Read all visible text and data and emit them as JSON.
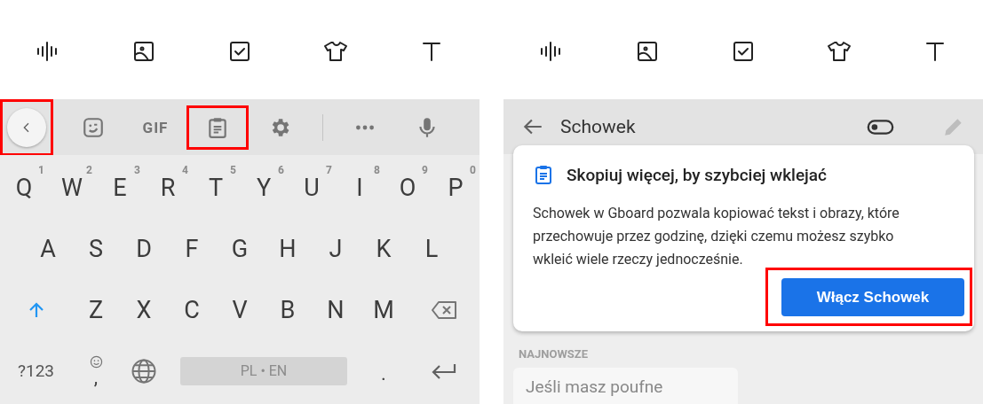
{
  "left_panel": {
    "top_toolbar": [
      {
        "kind": "voice"
      },
      {
        "kind": "image"
      },
      {
        "kind": "checkbox"
      },
      {
        "kind": "shirt"
      },
      {
        "kind": "text"
      }
    ],
    "keyboard_strip": [
      {
        "kind": "back",
        "highlighted": true
      },
      {
        "kind": "sticker",
        "highlighted": false
      },
      {
        "kind": "gif",
        "label": "GIF",
        "highlighted": false
      },
      {
        "kind": "clipboard",
        "highlighted": true
      },
      {
        "kind": "settings",
        "highlighted": false
      },
      {
        "kind": "divider",
        "highlighted": false
      },
      {
        "kind": "more",
        "highlighted": false
      },
      {
        "kind": "mic",
        "highlighted": false
      }
    ],
    "key_rows": [
      [
        {
          "kind": "letter",
          "label": "Q",
          "hint": "1"
        },
        {
          "kind": "letter",
          "label": "W",
          "hint": "2"
        },
        {
          "kind": "letter",
          "label": "E",
          "hint": "3"
        },
        {
          "kind": "letter",
          "label": "R",
          "hint": "4"
        },
        {
          "kind": "letter",
          "label": "T",
          "hint": "5"
        },
        {
          "kind": "letter",
          "label": "Y",
          "hint": "6"
        },
        {
          "kind": "letter",
          "label": "U",
          "hint": "7"
        },
        {
          "kind": "letter",
          "label": "I",
          "hint": "8"
        },
        {
          "kind": "letter",
          "label": "O",
          "hint": "9"
        },
        {
          "kind": "letter",
          "label": "P",
          "hint": "0"
        }
      ],
      [
        {
          "kind": "letter",
          "label": "A"
        },
        {
          "kind": "letter",
          "label": "S"
        },
        {
          "kind": "letter",
          "label": "D"
        },
        {
          "kind": "letter",
          "label": "F"
        },
        {
          "kind": "letter",
          "label": "G"
        },
        {
          "kind": "letter",
          "label": "H"
        },
        {
          "kind": "letter",
          "label": "J"
        },
        {
          "kind": "letter",
          "label": "K"
        },
        {
          "kind": "letter",
          "label": "L"
        }
      ],
      [
        {
          "kind": "shift"
        },
        {
          "kind": "letter",
          "label": "Z"
        },
        {
          "kind": "letter",
          "label": "X"
        },
        {
          "kind": "letter",
          "label": "C"
        },
        {
          "kind": "letter",
          "label": "V"
        },
        {
          "kind": "letter",
          "label": "B"
        },
        {
          "kind": "letter",
          "label": "N"
        },
        {
          "kind": "letter",
          "label": "M"
        },
        {
          "kind": "backspace"
        }
      ],
      [
        {
          "kind": "symbols",
          "label": "?123"
        },
        {
          "kind": "emoji_comma",
          "label": ","
        },
        {
          "kind": "globe"
        },
        {
          "kind": "space",
          "label": "PL • EN"
        },
        {
          "kind": "period",
          "label": "."
        },
        {
          "kind": "enter"
        }
      ]
    ]
  },
  "right_panel": {
    "top_toolbar": [
      {
        "kind": "voice"
      },
      {
        "kind": "image"
      },
      {
        "kind": "checkbox"
      },
      {
        "kind": "shirt"
      },
      {
        "kind": "text"
      }
    ],
    "header": {
      "title": "Schowek"
    },
    "card": {
      "title": "Skopiuj więcej, by szybciej wklejać",
      "body": "Schowek w Gboard pozwala kopiować tekst i obrazy, które przechowuje przez godzinę, dzięki czemu możesz szybko wkleić wiele rzeczy jednocześnie.",
      "button": {
        "label": "Włącz Schowek",
        "highlighted": true
      }
    },
    "section_label": "NAJNOWSZE",
    "clips": [
      {
        "text": "Jeśli masz poufne"
      }
    ]
  }
}
